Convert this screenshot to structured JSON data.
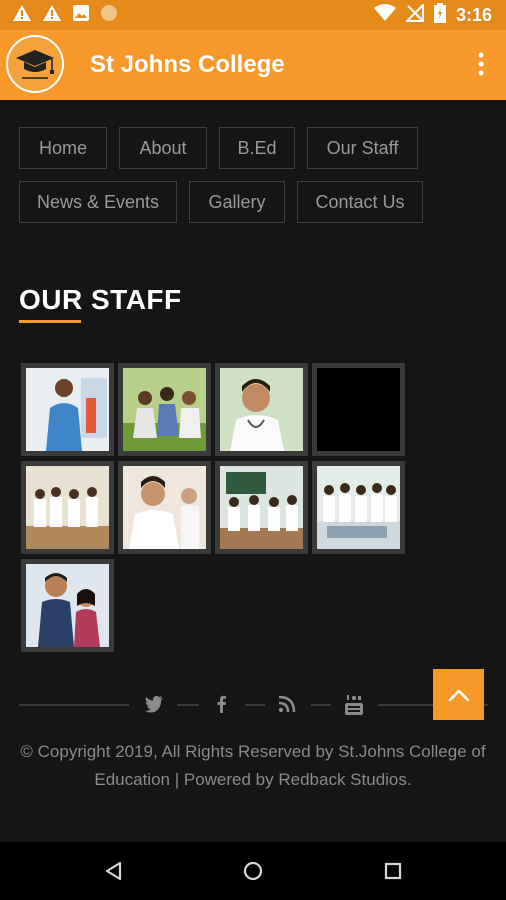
{
  "status_bar": {
    "time": "3:16"
  },
  "app_bar": {
    "title": "St Johns College"
  },
  "nav": {
    "items": [
      {
        "label": "Home"
      },
      {
        "label": "About"
      },
      {
        "label": "B.Ed"
      },
      {
        "label": "Our Staff"
      },
      {
        "label": "News & Events"
      },
      {
        "label": "Gallery"
      },
      {
        "label": "Contact Us"
      }
    ]
  },
  "section": {
    "title": "OUR STAFF"
  },
  "gallery": {
    "count": 9
  },
  "footer": {
    "social_icons": [
      "twitter-icon",
      "facebook-icon",
      "rss-icon",
      "youtube-icon"
    ],
    "copyright_prefix": "© Copyright 2019, All Rights Reserved by St.Johns College of Education | Powered by ",
    "powered_by": "Redback Studios",
    "copyright_suffix": "."
  },
  "colors": {
    "accent": "#f6982a",
    "status_bar": "#e68a1a",
    "background": "#151515"
  }
}
